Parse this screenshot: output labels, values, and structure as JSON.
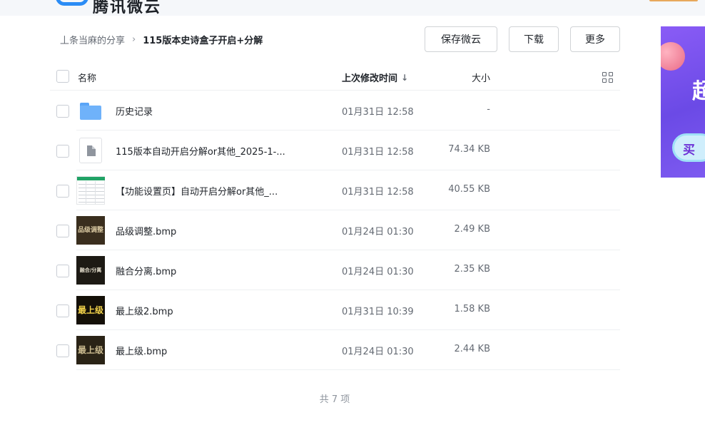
{
  "brand": {
    "name": "腾讯微云"
  },
  "breadcrumb": {
    "parent": "丄条当麻的分享",
    "separator": "›",
    "current": "115版本史诗盒子开启+分解"
  },
  "actions": {
    "save": "保存微云",
    "download": "下载",
    "more": "更多"
  },
  "table": {
    "headers": {
      "name": "名称",
      "time": "上次修改时间",
      "size": "大小"
    },
    "sort_icon": "↓"
  },
  "rows": [
    {
      "icon": "folder-icon",
      "name": "历史记录",
      "time": "01月31日 12:58",
      "size": "-"
    },
    {
      "icon": "doc-icon",
      "name": "115版本自动开启分解or其他_2025-1-...",
      "time": "01月31日 12:58",
      "size": "74.34 KB"
    },
    {
      "icon": "sheet-thumb",
      "name": "【功能设置页】自动开启分解or其他_...",
      "time": "01月31日 12:58",
      "size": "40.55 KB"
    },
    {
      "icon": "image-thumb",
      "thumb_text": "品级调整",
      "name": "品级调整.bmp",
      "time": "01月24日 01:30",
      "size": "2.49 KB"
    },
    {
      "icon": "image-thumb",
      "thumb_text": "融合/分离",
      "name": "融合分离.bmp",
      "time": "01月24日 01:30",
      "size": "2.35 KB"
    },
    {
      "icon": "image-thumb",
      "thumb_text": "最上级",
      "name": "最上级2.bmp",
      "time": "01月31日 10:39",
      "size": "1.58 KB"
    },
    {
      "icon": "image-thumb",
      "thumb_text": "最上级",
      "name": "最上级.bmp",
      "time": "01月24日 01:30",
      "size": "2.44 KB"
    }
  ],
  "footer": {
    "count_text": "共 7 项"
  },
  "ad": {
    "text_big": "超",
    "text_pill": "买"
  },
  "colors": {
    "accent": "#2b8cf5",
    "folder": "#6fb2fa",
    "ad_purple": "#7d5af0"
  }
}
